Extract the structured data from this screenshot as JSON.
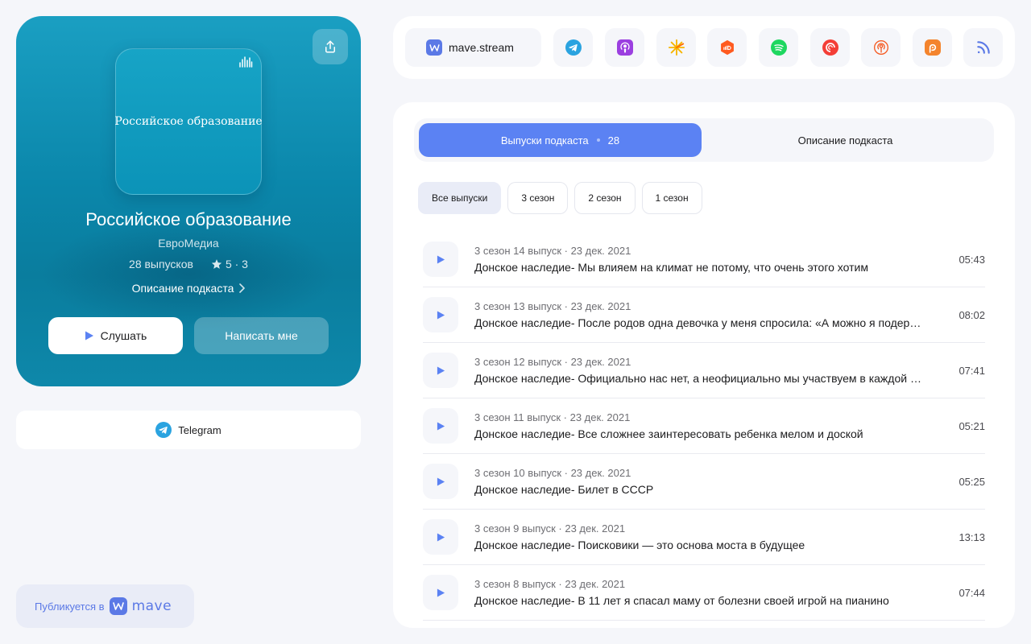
{
  "podcast": {
    "cover_text": "Российское образование",
    "title": "Российское образование",
    "author": "ЕвроМедиа",
    "episodes_count": "28 выпусков",
    "rating": "5 · 3",
    "description_link": "Описание подкаста",
    "listen_label": "Слушать",
    "write_label": "Написать мне"
  },
  "telegram": {
    "label": "Telegram"
  },
  "published": {
    "label": "Публикуется в",
    "brand": "mave"
  },
  "platforms": {
    "mave_stream": "mave.stream",
    "icons": [
      "telegram-icon",
      "apple-podcasts-icon",
      "yandex-music-icon",
      "soundcloud-icon",
      "spotify-icon",
      "pocket-casts-icon",
      "castbox-icon",
      "podcast-addict-icon",
      "rss-icon"
    ]
  },
  "tabs": {
    "episodes_label": "Выпуски подкаста",
    "episodes_count": "28",
    "description_label": "Описание подкаста"
  },
  "filters": [
    "Все выпуски",
    "3 сезон",
    "2 сезон",
    "1 сезон"
  ],
  "episodes": [
    {
      "meta": "3 сезон 14 выпуск · 23 дек. 2021",
      "title": "Донское наследие- Мы влияем на климат не потому, что очень этого хотим",
      "duration": "05:43"
    },
    {
      "meta": "3 сезон 13 выпуск · 23 дек. 2021",
      "title": "Донское наследие- После родов одна девочка у меня спросила: «А можно я подержу ребенка?»",
      "duration": "08:02"
    },
    {
      "meta": "3 сезон 12 выпуск · 23 дек. 2021",
      "title": "Донское наследие- Официально нас нет, а неофициально мы участвуем в каждой экспедиции",
      "duration": "07:41"
    },
    {
      "meta": "3 сезон 11 выпуск · 23 дек. 2021",
      "title": "Донское наследие- Все сложнее заинтересовать ребенка мелом и доской",
      "duration": "05:21"
    },
    {
      "meta": "3 сезон 10 выпуск · 23 дек. 2021",
      "title": "Донское наследие- Билет в СССР",
      "duration": "05:25"
    },
    {
      "meta": "3 сезон 9 выпуск · 23 дек. 2021",
      "title": "Донское наследие- Поисковики — это основа моста в будущее",
      "duration": "13:13"
    },
    {
      "meta": "3 сезон 8 выпуск · 23 дек. 2021",
      "title": "Донское наследие- В 11 лет я спасал маму от болезни своей игрой на пианино",
      "duration": "07:44"
    }
  ],
  "colors": {
    "accent": "#5b82f3",
    "hero": "#0b87ab",
    "brand": "#5b79e6"
  }
}
